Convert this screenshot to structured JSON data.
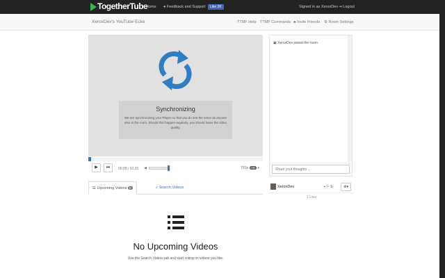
{
  "nav": {
    "brand": "TogetherTube",
    "home": "Home",
    "feedback": "Feedback and Support",
    "like": "Like 3K",
    "signed_in": "Signed in as XeroxDev",
    "logout": "Logout"
  },
  "room": {
    "title": "XeroxDev's YouTube Ecke",
    "help": "TTMF Help",
    "commands": "TTMF Commands",
    "invite": "Invite Friends",
    "settings": "Room Settings"
  },
  "player": {
    "sync_title": "Synchronizing",
    "sync_text": "We are synchronizing your Player so that you do see the same as anyone else in the room. Should this happen regularly, you should lower the video quality.",
    "time": "00:00 / 02:26",
    "quality": "720p",
    "hd": "HD",
    "progress": 0.01,
    "volume": 1.0
  },
  "chat": {
    "message": "XeroxDev joined the room.",
    "placeholder": "Share your thoughts ..."
  },
  "tabs": {
    "upcoming": "Upcoming Videos",
    "upcoming_count": "0",
    "search": "Search Videos"
  },
  "users": {
    "name": "XeroxDev",
    "count": "1 User"
  },
  "empty": {
    "title": "No Upcoming Videos",
    "text": "Use the Search Videos tab and start voting on videos you like."
  }
}
